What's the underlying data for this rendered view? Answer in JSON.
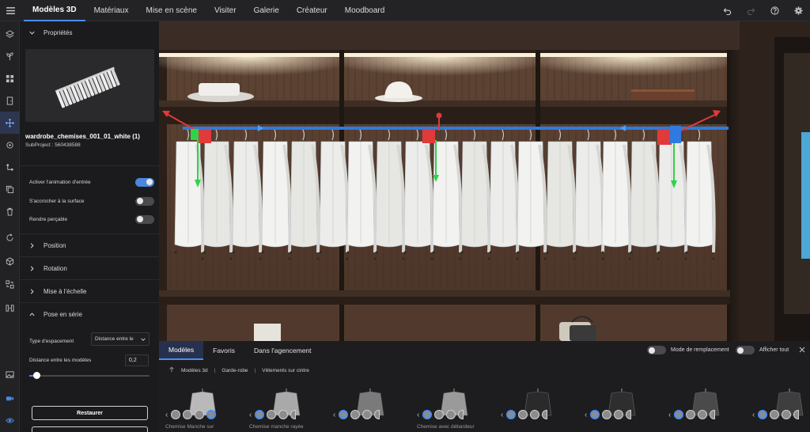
{
  "topbar": {
    "menu_icon": "hamburger-icon",
    "tabs": [
      {
        "label": "Modèles 3D",
        "active": true
      },
      {
        "label": "Matériaux",
        "active": false
      },
      {
        "label": "Mise en scène",
        "active": false
      },
      {
        "label": "Visiter",
        "active": false
      },
      {
        "label": "Galerie",
        "active": false
      },
      {
        "label": "Créateur",
        "active": false
      },
      {
        "label": "Moodboard",
        "active": false
      }
    ],
    "right_icons": [
      "undo-icon",
      "redo-icon",
      "help-icon",
      "settings-icon"
    ]
  },
  "rail": {
    "icons": [
      "layers-icon",
      "plant-icon",
      "grid-icon",
      "door-icon",
      "move-icon",
      "target-icon",
      "node-icon",
      "copy-icon",
      "trash-icon",
      "rotate-icon",
      "cube-icon",
      "arrange-icon",
      "split-icon",
      "image-icon",
      "camera-icon",
      "eye-icon"
    ],
    "active_index": 4
  },
  "panel": {
    "properties_label": "Propriétés",
    "model_name": "wardrobe_chemises_001_01_white (1)",
    "subproject": "SubProject : 560438588",
    "toggles": [
      {
        "label": "Activer l'animation d'entrée",
        "on": true
      },
      {
        "label": "S'accrocher à la surface",
        "on": false
      },
      {
        "label": "Rendre perçable",
        "on": false
      }
    ],
    "sections": [
      "Position",
      "Rotation",
      "Mise à l'échelle",
      "Pose en série"
    ],
    "spacing_label": "Type d'espacement",
    "spacing_value": "Distance entre le",
    "distance_label": "Distance entre les modèles",
    "distance_value": "0,2",
    "slider_fraction": 0.06,
    "restore_label": "Restaurer"
  },
  "catalog": {
    "tabs": [
      {
        "label": "Modèles",
        "active": true
      },
      {
        "label": "Favoris",
        "active": false
      },
      {
        "label": "Dans l'agencement",
        "active": false
      }
    ],
    "replace_mode_label": "Mode de remplacement",
    "show_all_label": "Afficher tout",
    "breadcrumb": [
      "Modèles 3d",
      "Garde-robe",
      "Vêtements sur cintre"
    ],
    "cards": [
      {
        "name": "Chemise Manche sur",
        "shirt": "#b9b9b9"
      },
      {
        "name": "Chemise manche rayée",
        "shirt": "#a9a9a9"
      },
      {
        "name": "",
        "shirt": "#7a7a7a"
      },
      {
        "name": "Chemise avec débardeur",
        "shirt": "#9a9a9a"
      },
      {
        "name": "",
        "shirt": "#2a2a2a"
      },
      {
        "name": "",
        "shirt": "#2e2e2e"
      },
      {
        "name": "",
        "shirt": "#4a4a4a"
      },
      {
        "name": "",
        "shirt": "#3e3e3e"
      }
    ]
  },
  "colors": {
    "accent": "#4a8df0",
    "gizmo_red": "#e03a3a",
    "gizmo_green": "#2fd24a",
    "gizmo_blue": "#2f7ae0"
  }
}
